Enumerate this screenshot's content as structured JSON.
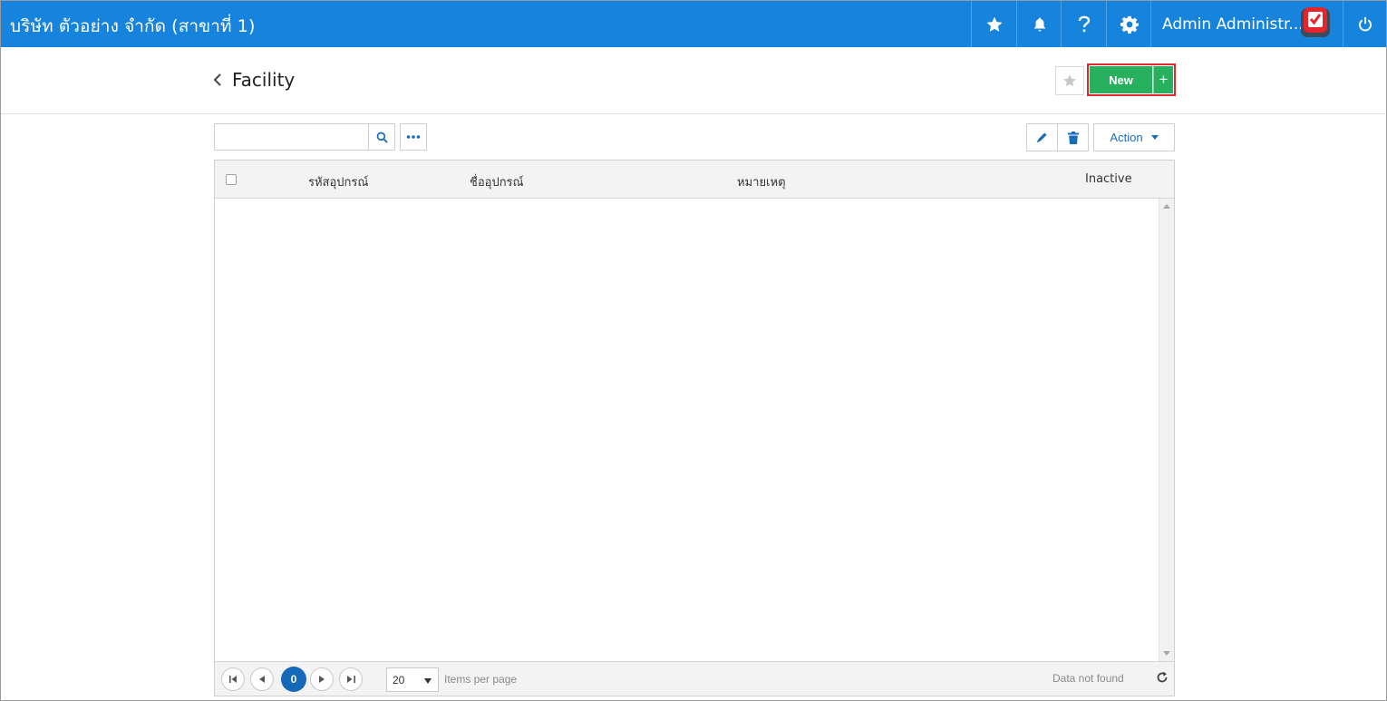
{
  "topbar": {
    "company": "บริษัท ตัวอย่าง จำกัด (สาขาที่ 1)",
    "user_name": "Admin Administr...",
    "icons": [
      "star-icon",
      "bell-icon",
      "help-icon",
      "gear-icon",
      "power-icon"
    ],
    "bar_color": "#1683dd"
  },
  "header": {
    "title": "Facility",
    "new_label": "New",
    "new_plus": "+"
  },
  "toolbar": {
    "search_placeholder": "",
    "action_label": "Action"
  },
  "grid": {
    "columns": [
      "รหัสอุปกรณ์",
      "ชื่ออุปกรณ์",
      "หมายเหตุ",
      "Inactive"
    ],
    "rows": []
  },
  "pager": {
    "current_page": "0",
    "page_size": "20",
    "items_per_page": "Items per page",
    "status": "Data not found"
  },
  "colors": {
    "accent": "#1683dd",
    "new_button": "#27b15f",
    "highlight_border": "#e2262c",
    "pager_active": "#1669b8"
  }
}
